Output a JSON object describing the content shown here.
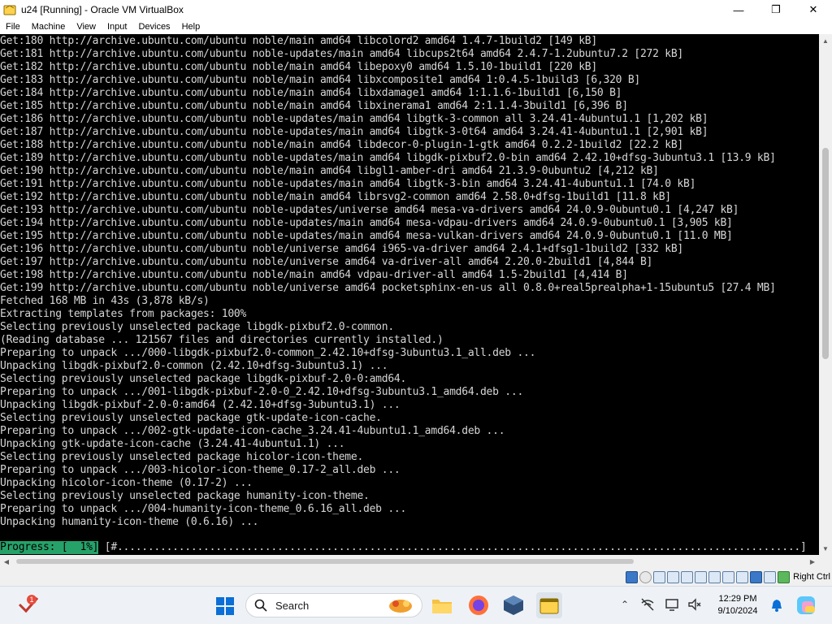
{
  "window": {
    "title": "u24 [Running] - Oracle VM VirtualBox",
    "minimize_glyph": "—",
    "maximize_glyph": "❐",
    "close_glyph": "✕"
  },
  "menu": [
    "File",
    "Machine",
    "View",
    "Input",
    "Devices",
    "Help"
  ],
  "terminal": {
    "lines": [
      "Get:180 http://archive.ubuntu.com/ubuntu noble/main amd64 libcolord2 amd64 1.4.7-1build2 [149 kB]",
      "Get:181 http://archive.ubuntu.com/ubuntu noble-updates/main amd64 libcups2t64 amd64 2.4.7-1.2ubuntu7.2 [272 kB]",
      "Get:182 http://archive.ubuntu.com/ubuntu noble/main amd64 libepoxy0 amd64 1.5.10-1build1 [220 kB]",
      "Get:183 http://archive.ubuntu.com/ubuntu noble/main amd64 libxcomposite1 amd64 1:0.4.5-1build3 [6,320 B]",
      "Get:184 http://archive.ubuntu.com/ubuntu noble/main amd64 libxdamage1 amd64 1:1.1.6-1build1 [6,150 B]",
      "Get:185 http://archive.ubuntu.com/ubuntu noble/main amd64 libxinerama1 amd64 2:1.1.4-3build1 [6,396 B]",
      "Get:186 http://archive.ubuntu.com/ubuntu noble-updates/main amd64 libgtk-3-common all 3.24.41-4ubuntu1.1 [1,202 kB]",
      "Get:187 http://archive.ubuntu.com/ubuntu noble-updates/main amd64 libgtk-3-0t64 amd64 3.24.41-4ubuntu1.1 [2,901 kB]",
      "Get:188 http://archive.ubuntu.com/ubuntu noble/main amd64 libdecor-0-plugin-1-gtk amd64 0.2.2-1build2 [22.2 kB]",
      "Get:189 http://archive.ubuntu.com/ubuntu noble-updates/main amd64 libgdk-pixbuf2.0-bin amd64 2.42.10+dfsg-3ubuntu3.1 [13.9 kB]",
      "Get:190 http://archive.ubuntu.com/ubuntu noble/main amd64 libgl1-amber-dri amd64 21.3.9-0ubuntu2 [4,212 kB]",
      "Get:191 http://archive.ubuntu.com/ubuntu noble-updates/main amd64 libgtk-3-bin amd64 3.24.41-4ubuntu1.1 [74.0 kB]",
      "Get:192 http://archive.ubuntu.com/ubuntu noble/main amd64 librsvg2-common amd64 2.58.0+dfsg-1build1 [11.8 kB]",
      "Get:193 http://archive.ubuntu.com/ubuntu noble-updates/universe amd64 mesa-va-drivers amd64 24.0.9-0ubuntu0.1 [4,247 kB]",
      "Get:194 http://archive.ubuntu.com/ubuntu noble-updates/main amd64 mesa-vdpau-drivers amd64 24.0.9-0ubuntu0.1 [3,905 kB]",
      "Get:195 http://archive.ubuntu.com/ubuntu noble-updates/main amd64 mesa-vulkan-drivers amd64 24.0.9-0ubuntu0.1 [11.0 MB]",
      "Get:196 http://archive.ubuntu.com/ubuntu noble/universe amd64 i965-va-driver amd64 2.4.1+dfsg1-1build2 [332 kB]",
      "Get:197 http://archive.ubuntu.com/ubuntu noble/universe amd64 va-driver-all amd64 2.20.0-2build1 [4,844 B]",
      "Get:198 http://archive.ubuntu.com/ubuntu noble/main amd64 vdpau-driver-all amd64 1.5-2build1 [4,414 B]",
      "Get:199 http://archive.ubuntu.com/ubuntu noble/universe amd64 pocketsphinx-en-us all 0.8.0+real5prealpha+1-15ubuntu5 [27.4 MB]",
      "Fetched 168 MB in 43s (3,878 kB/s)",
      "Extracting templates from packages: 100%",
      "Selecting previously unselected package libgdk-pixbuf2.0-common.",
      "(Reading database ... 121567 files and directories currently installed.)",
      "Preparing to unpack .../000-libgdk-pixbuf2.0-common_2.42.10+dfsg-3ubuntu3.1_all.deb ...",
      "Unpacking libgdk-pixbuf2.0-common (2.42.10+dfsg-3ubuntu3.1) ...",
      "Selecting previously unselected package libgdk-pixbuf-2.0-0:amd64.",
      "Preparing to unpack .../001-libgdk-pixbuf-2.0-0_2.42.10+dfsg-3ubuntu3.1_amd64.deb ...",
      "Unpacking libgdk-pixbuf-2.0-0:amd64 (2.42.10+dfsg-3ubuntu3.1) ...",
      "Selecting previously unselected package gtk-update-icon-cache.",
      "Preparing to unpack .../002-gtk-update-icon-cache_3.24.41-4ubuntu1.1_amd64.deb ...",
      "Unpacking gtk-update-icon-cache (3.24.41-4ubuntu1.1) ...",
      "Selecting previously unselected package hicolor-icon-theme.",
      "Preparing to unpack .../003-hicolor-icon-theme_0.17-2_all.deb ...",
      "Unpacking hicolor-icon-theme (0.17-2) ...",
      "Selecting previously unselected package humanity-icon-theme.",
      "Preparing to unpack .../004-humanity-icon-theme_0.6.16_all.deb ...",
      "Unpacking humanity-icon-theme (0.6.16) ..."
    ],
    "progress_label": "Progress: [  1%]",
    "progress_bar": " [#...............................................................................................................]",
    "progress_percent": 1,
    "progress_color": "#26a269"
  },
  "statusbar": {
    "host_key": "Right Ctrl",
    "icons": [
      "hard-disk-icon",
      "optical-drive-icon",
      "audio-icon",
      "network-icon",
      "usb-icon",
      "shared-folders-icon",
      "display-icon",
      "video-capture-icon",
      "recording-icon",
      "cpu-icon",
      "mouse-integration-icon",
      "keyboard-icon"
    ]
  },
  "taskbar": {
    "search_placeholder": "Search",
    "weather_badge": "1",
    "time": "12:29 PM",
    "date": "9/10/2024",
    "apps": [
      "file-explorer-icon",
      "firefox-icon",
      "virtualbox-icon",
      "virtualbox-vm-icon"
    ]
  }
}
